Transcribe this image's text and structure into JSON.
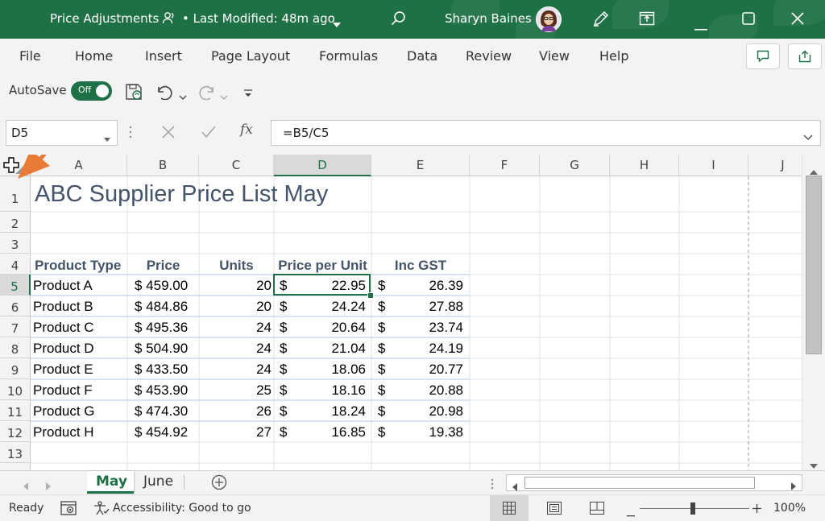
{
  "titlebar": {
    "doc_title": "Price Adjustments",
    "modified": "• Last Modified: 48m ago",
    "user_name": "Sharyn Baines"
  },
  "ribbon": {
    "tabs": [
      "File",
      "Home",
      "Insert",
      "Page Layout",
      "Formulas",
      "Data",
      "Review",
      "View",
      "Help"
    ]
  },
  "qat": {
    "autosave_label": "AutoSave",
    "toggle_text": "Off"
  },
  "formula_bar": {
    "name_box": "D5",
    "fx": "fx",
    "formula": "=B5/C5"
  },
  "columns": [
    "A",
    "B",
    "C",
    "D",
    "E",
    "F",
    "G",
    "H",
    "I",
    "J"
  ],
  "rows": [
    "1",
    "2",
    "3",
    "4",
    "5",
    "6",
    "7",
    "8",
    "9",
    "10",
    "11",
    "12",
    "13"
  ],
  "sheet": {
    "title": "ABC Supplier Price List May",
    "headers": [
      "Product Type",
      "Price",
      "Units",
      "Price per Unit",
      "Inc GST"
    ],
    "data": [
      {
        "product": "Product A",
        "price": "$ 459.00",
        "units": "20",
        "ppu": "22.95",
        "gst": "26.39"
      },
      {
        "product": "Product B",
        "price": "$ 484.86",
        "units": "20",
        "ppu": "24.24",
        "gst": "27.88"
      },
      {
        "product": "Product C",
        "price": "$ 495.36",
        "units": "24",
        "ppu": "20.64",
        "gst": "23.74"
      },
      {
        "product": "Product D",
        "price": "$ 504.90",
        "units": "24",
        "ppu": "21.04",
        "gst": "24.19"
      },
      {
        "product": "Product E",
        "price": "$ 433.50",
        "units": "24",
        "ppu": "18.06",
        "gst": "20.77"
      },
      {
        "product": "Product F",
        "price": "$ 453.90",
        "units": "25",
        "ppu": "18.16",
        "gst": "20.88"
      },
      {
        "product": "Product G",
        "price": "$ 474.30",
        "units": "26",
        "ppu": "18.24",
        "gst": "20.98"
      },
      {
        "product": "Product H",
        "price": "$ 454.92",
        "units": "27",
        "ppu": "16.85",
        "gst": "19.38"
      }
    ],
    "currency_symbol": "$"
  },
  "sheet_tabs": [
    "May",
    "June"
  ],
  "status": {
    "ready": "Ready",
    "accessibility": "Accessibility: Good to go",
    "zoom": "100%"
  },
  "colors": {
    "excel_green": "#1e7145",
    "arrow_orange": "#e87b35",
    "header_text": "#44546a"
  },
  "icons": [
    "search-icon",
    "avatar",
    "pen-icon",
    "minimize-icon",
    "maximize-icon",
    "close-icon",
    "comment-icon",
    "share-icon",
    "save-icon",
    "undo-icon",
    "redo-icon",
    "customize-qat-icon",
    "cancel-icon",
    "enter-icon",
    "select-all-icon",
    "add-sheet-icon",
    "macro-record-icon",
    "accessibility-icon",
    "normal-view-icon",
    "page-layout-view-icon",
    "page-break-view-icon"
  ]
}
